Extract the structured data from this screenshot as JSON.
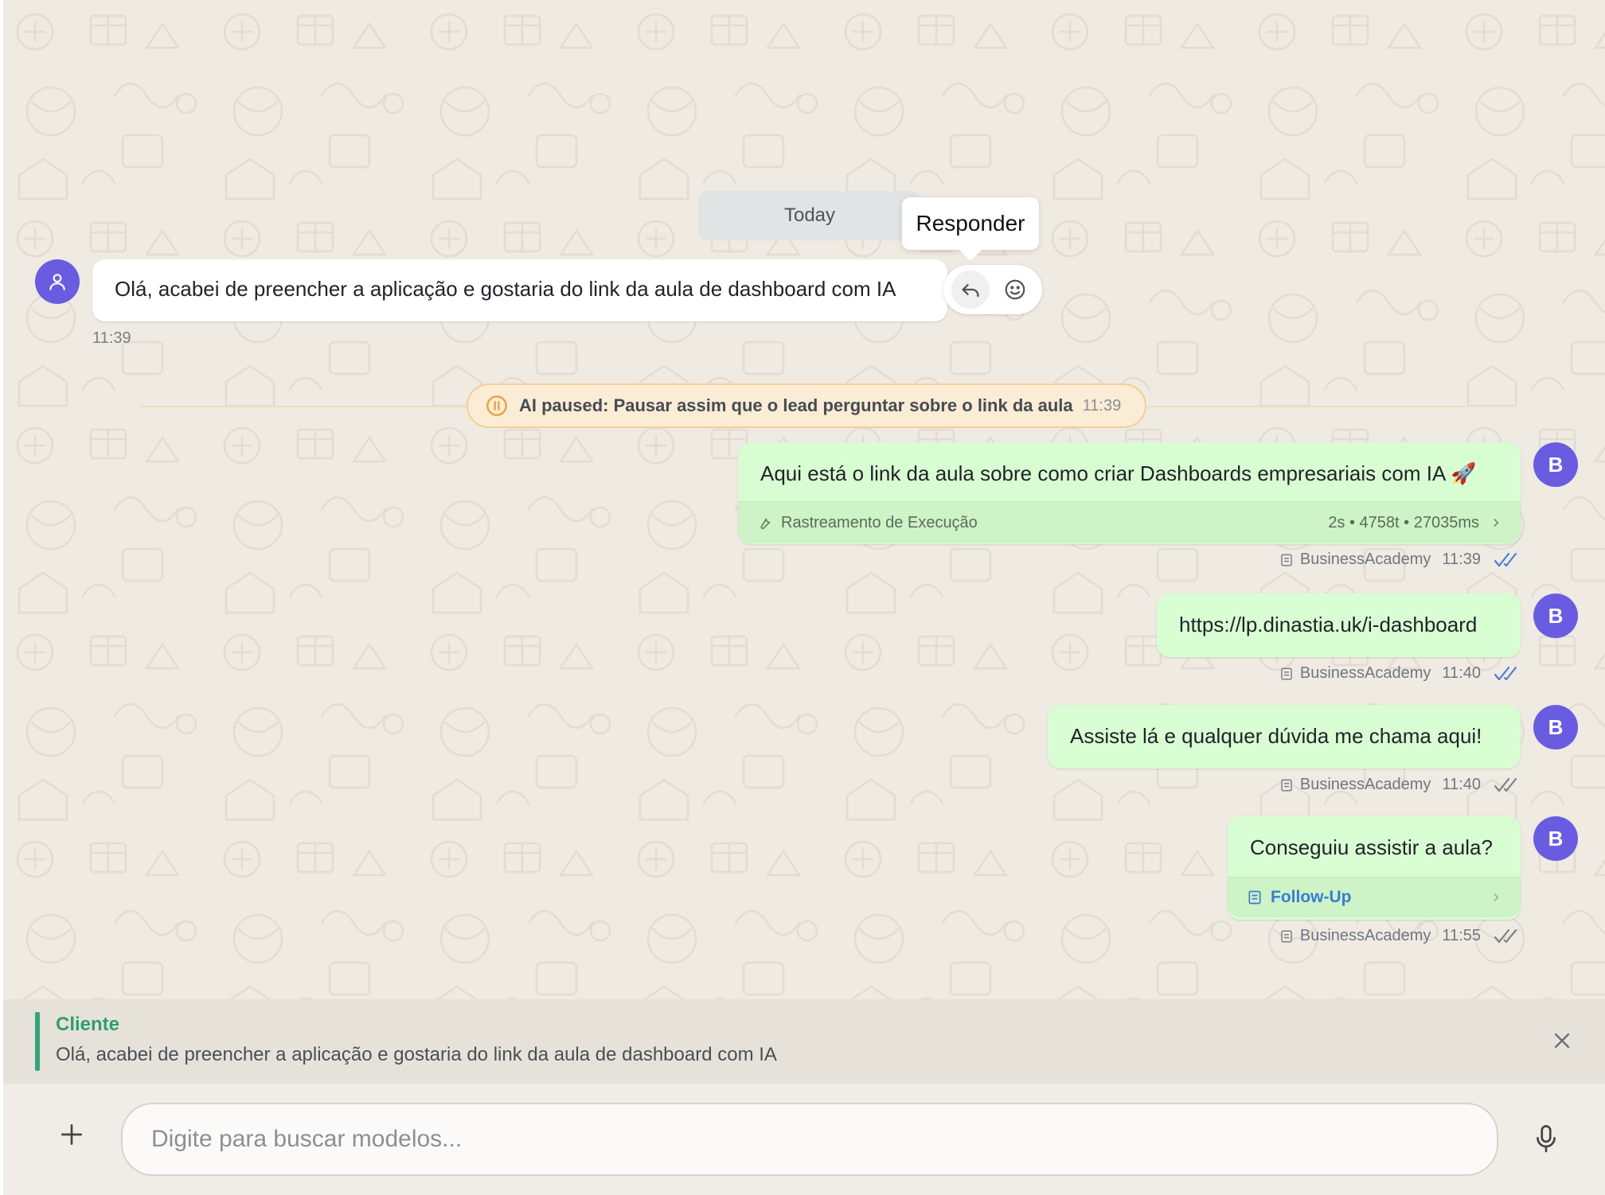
{
  "date_divider": "Today",
  "tooltip": "Responder",
  "incoming": {
    "text": "Olá, acabei de preencher a aplicação e gostaria do link da aula de dashboard com IA",
    "time": "11:39"
  },
  "ai_paused": {
    "label": "AI paused: Pausar assim que o lead perguntar sobre o link da aula",
    "time": "11:39"
  },
  "outgoing": [
    {
      "avatar": "B",
      "text": "Aqui está o link da aula sobre como criar Dashboards empresariais com IA 🚀",
      "trace_label": "Rastreamento de Execução",
      "trace_stats": "2s • 4758t • 27035ms",
      "sender": "BusinessAcademy",
      "time": "11:39",
      "read": true
    },
    {
      "avatar": "B",
      "text": "https://lp.dinastia.uk/i-dashboard",
      "sender": "BusinessAcademy",
      "time": "11:40",
      "read": true
    },
    {
      "avatar": "B",
      "text": "Assiste lá e qualquer dúvida me chama aqui!",
      "sender": "BusinessAcademy",
      "time": "11:40",
      "read": false
    },
    {
      "avatar": "B",
      "text": "Conseguiu assistir a aula?",
      "followup_label": "Follow-Up",
      "sender": "BusinessAcademy",
      "time": "11:55",
      "read": false
    }
  ],
  "reply_preview": {
    "name": "Cliente",
    "text": "Olá, acabei de preencher a aplicação e gostaria do link da aula de dashboard com IA"
  },
  "composer": {
    "placeholder": "Digite para buscar modelos..."
  },
  "colors": {
    "accent_purple": "#6a5ce0",
    "outgoing_bubble": "#d9fdd3",
    "read_tick": "#4a7fd6",
    "reply_green": "#2f9e6f",
    "paused_orange": "#e9a23b"
  }
}
